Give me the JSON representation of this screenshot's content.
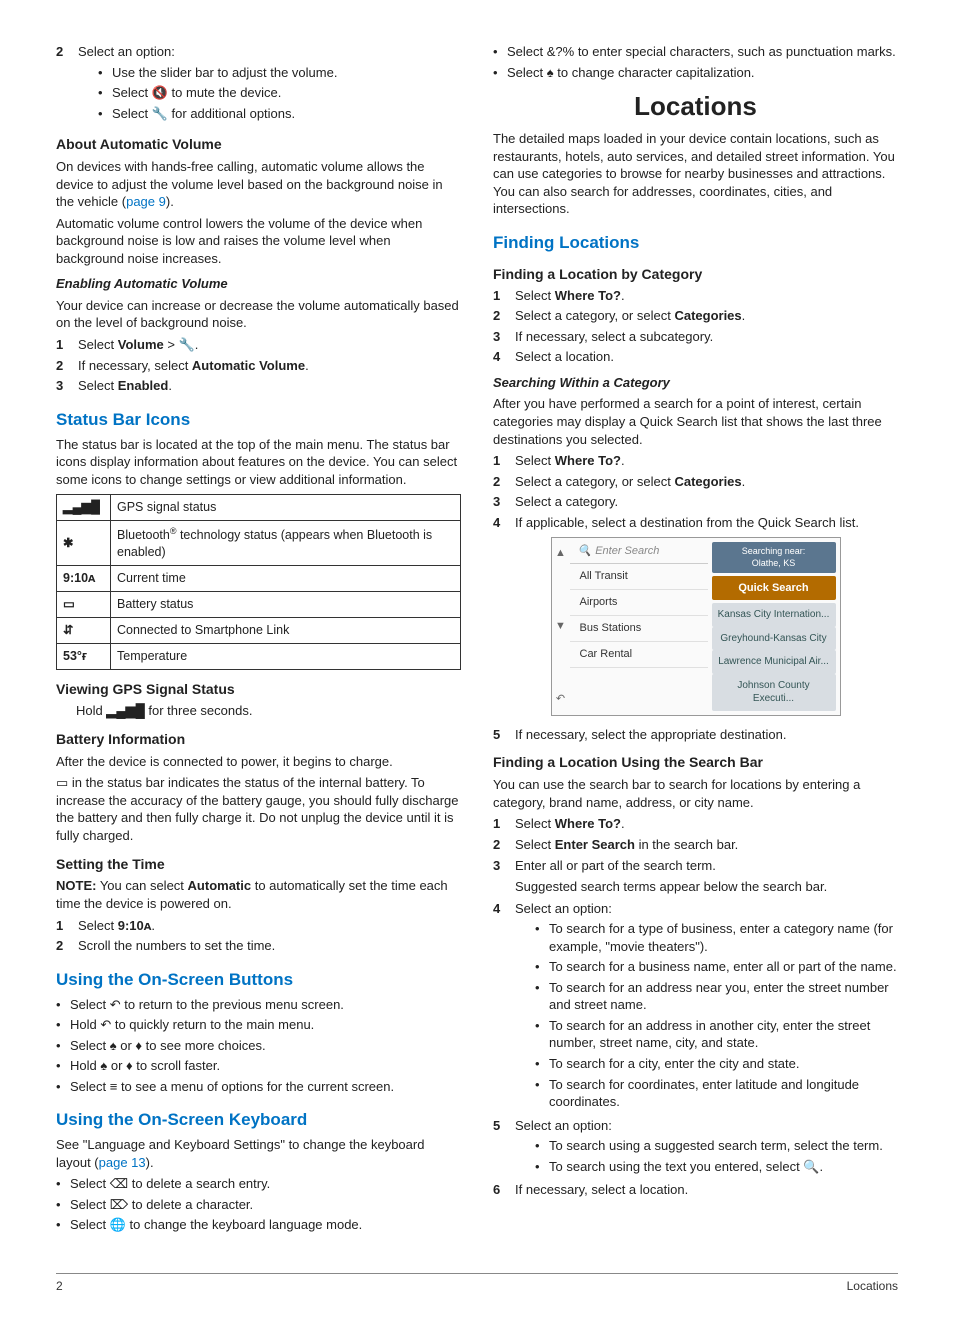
{
  "left": {
    "step2_intro": "Select an option:",
    "step2_opts": [
      "Use the slider bar to adjust the volume.",
      "Select 🔇 to mute the device.",
      "Select 🔧 for additional options."
    ],
    "about_av_h": "About Automatic Volume",
    "about_av_p1a": "On devices with hands-free calling, automatic volume allows the device to adjust the volume level based on the background noise in the vehicle (",
    "about_av_link": "page 9",
    "about_av_p1b": ").",
    "about_av_p2": "Automatic volume control lowers the volume of the device when background noise is low and raises the volume level when background noise increases.",
    "enable_av_h": "Enabling Automatic Volume",
    "enable_av_p": "Your device can increase or decrease the volume automatically based on the level of background noise.",
    "enable_av_steps": [
      {
        "pre": "Select ",
        "bold": "Volume",
        "post": " > 🔧."
      },
      {
        "pre": "If necessary, select ",
        "bold": "Automatic Volume",
        "post": "."
      },
      {
        "pre": "Select ",
        "bold": "Enabled",
        "post": "."
      }
    ],
    "status_h": "Status Bar Icons",
    "status_p": "The status bar is located at the top of the main menu. The status bar icons display information about features on the device. You can select some icons to change settings or view additional information.",
    "icons": [
      {
        "g": "▂▄▆█",
        "d": "GPS signal status"
      },
      {
        "g": "✱",
        "d": "Bluetooth® technology status (appears when Bluetooth is enabled)"
      },
      {
        "g": "9:10ᴀ",
        "d": "Current time"
      },
      {
        "g": "▭",
        "d": "Battery status"
      },
      {
        "g": "⇵",
        "d": "Connected to Smartphone Link"
      },
      {
        "g": "53°ғ",
        "d": "Temperature"
      }
    ],
    "gps_h": "Viewing GPS Signal Status",
    "gps_p_a": "Hold ",
    "gps_glyph": "▂▄▆█",
    "gps_p_b": " for three seconds.",
    "batt_h": "Battery Information",
    "batt_p1": "After the device is connected to power, it begins to charge.",
    "batt_p2": "▭ in the status bar indicates the status of the internal battery. To increase the accuracy of the battery gauge, you should fully discharge the battery and then fully charge it. Do not unplug the device until it is fully charged.",
    "time_h": "Setting the Time",
    "time_note_a": "NOTE:",
    "time_note_b": " You can select ",
    "time_note_bold": "Automatic",
    "time_note_c": " to automatically set the time each time the device is powered on.",
    "time_steps": [
      {
        "pre": "Select ",
        "bold": "9:10ᴀ",
        "post": "."
      },
      {
        "pre": "Scroll the numbers to set the time.",
        "bold": "",
        "post": ""
      }
    ],
    "osb_h": "Using the On-Screen Buttons",
    "osb_items": [
      "Select ↶ to return to the previous menu screen.",
      "Hold ↶ to quickly return to the main menu.",
      "Select ♠ or ♦ to see more choices.",
      "Hold ♠ or ♦ to scroll faster.",
      "Select ≡ to see a menu of options for the current screen."
    ],
    "osk_h": "Using the On-Screen Keyboard",
    "osk_p_a": "See \"Language and Keyboard Settings\" to change the keyboard layout (",
    "osk_link": "page 13",
    "osk_p_b": ").",
    "osk_items": [
      "Select ⌫ to delete a search entry.",
      "Select ⌦ to delete a character.",
      "Select 🌐 to change the keyboard language mode."
    ]
  },
  "right": {
    "osk_extra": [
      "Select &?% to enter special characters, such as punctuation marks.",
      "Select ♠ to change character capitalization."
    ],
    "loc_h": "Locations",
    "loc_p": "The detailed maps loaded in your device contain locations, such as restaurants, hotels, auto services, and detailed street information. You can use categories to browse for nearby businesses and attractions. You can also search for addresses, coordinates, cities, and intersections.",
    "find_h": "Finding Locations",
    "cat_h": "Finding a Location by Category",
    "cat_steps": [
      {
        "pre": "Select ",
        "bold": "Where To?",
        "post": "."
      },
      {
        "pre": "Select a category, or select ",
        "bold": "Categories",
        "post": "."
      },
      {
        "pre": "If necessary, select a subcategory.",
        "bold": "",
        "post": ""
      },
      {
        "pre": "Select a location.",
        "bold": "",
        "post": ""
      }
    ],
    "search_cat_h": "Searching Within a Category",
    "search_cat_p": "After you have performed a search for a point of interest, certain categories may display a Quick Search list that shows the last three destinations you selected.",
    "search_cat_steps": [
      {
        "pre": "Select ",
        "bold": "Where To?",
        "post": "."
      },
      {
        "pre": "Select a category, or select ",
        "bold": "Categories",
        "post": "."
      },
      {
        "pre": "Select a category.",
        "bold": "",
        "post": ""
      },
      {
        "pre": "If applicable, select a destination from the Quick Search list.",
        "bold": "",
        "post": ""
      }
    ],
    "shot": {
      "search_placeholder": "Enter Search",
      "near": "Searching near:\nOlathe, KS",
      "left_items": [
        "All Transit",
        "Airports",
        "Bus Stations",
        "Car Rental"
      ],
      "qs": "Quick Search",
      "dests": [
        "Kansas City Internation...",
        "Greyhound-Kansas City",
        "Lawrence Municipal Air...",
        "Johnson County Executi..."
      ]
    },
    "search_cat_step5": "If necessary, select the appropriate destination.",
    "bar_h": "Finding a Location Using the Search Bar",
    "bar_p": "You can use the search bar to search for locations by entering a category, brand name, address, or city name.",
    "bar_steps_1_3": [
      {
        "pre": "Select ",
        "bold": "Where To?",
        "post": "."
      },
      {
        "pre": "Select ",
        "bold": "Enter Search",
        "post": " in the search bar."
      },
      {
        "pre": "Enter all or part of the search term.",
        "bold": "",
        "post": ""
      }
    ],
    "bar_after3": "Suggested search terms appear below the search bar.",
    "bar_step4": "Select an option:",
    "bar_step4_opts": [
      "To search for a type of business, enter a category name (for example, \"movie theaters\").",
      "To search for a business name, enter all or part of the name.",
      "To search for an address near you, enter the street number and street name.",
      "To search for an address in another city, enter the street number, street name, city, and state.",
      "To search for a city, enter the city and state.",
      "To search for coordinates, enter latitude and longitude coordinates."
    ],
    "bar_step5": "Select an option:",
    "bar_step5_opts": [
      "To search using a suggested search term, select the term.",
      "To search using the text you entered, select 🔍."
    ],
    "bar_step6": "If necessary, select a location."
  },
  "footer": {
    "page": "2",
    "section": "Locations"
  }
}
